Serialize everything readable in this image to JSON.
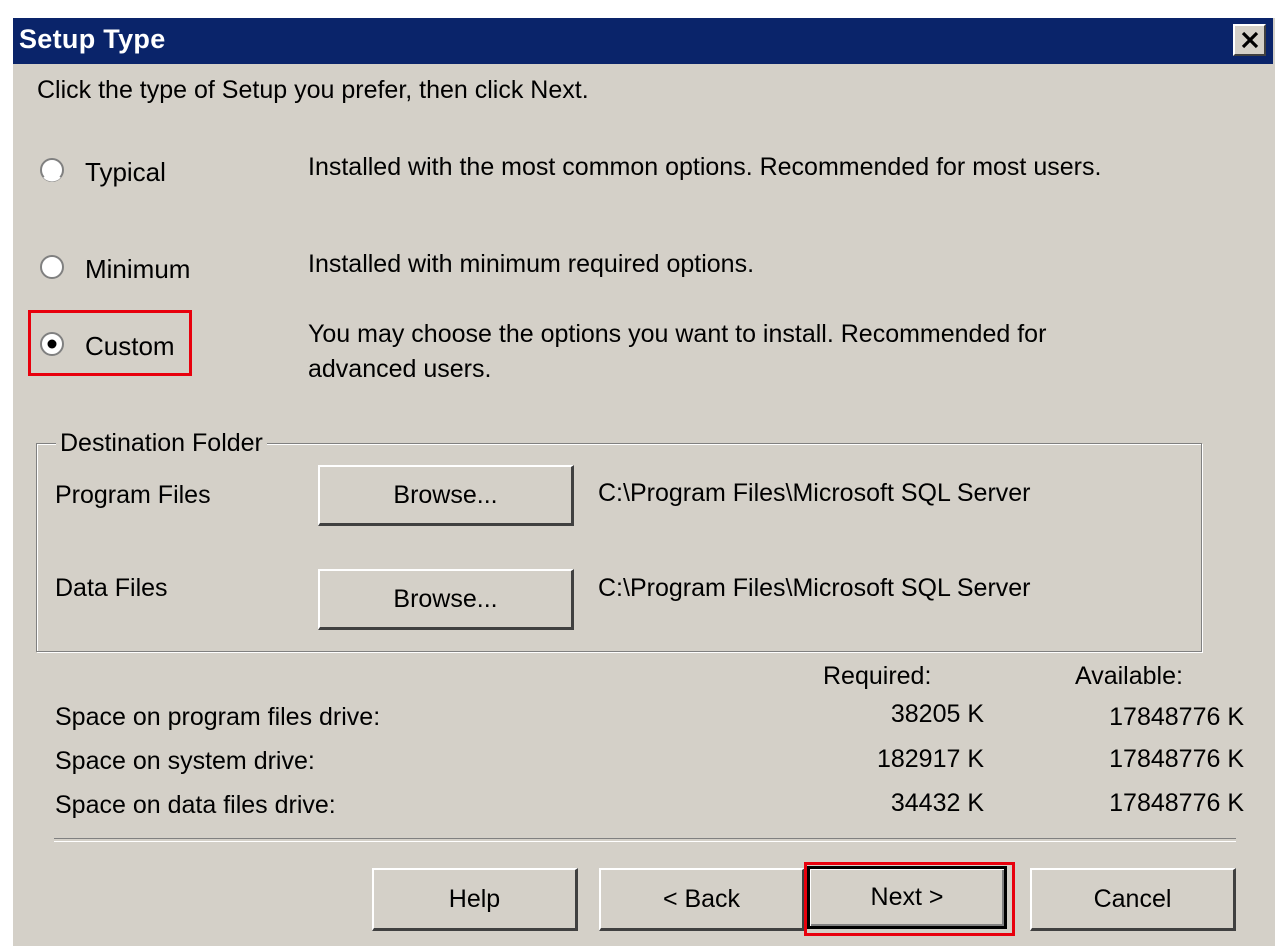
{
  "window": {
    "title": "Setup Type",
    "close_icon": "close-icon"
  },
  "instruction": "Click the type of Setup you prefer, then click Next.",
  "setup_options": [
    {
      "label": "Typical",
      "description": "Installed with the most common options. Recommended for most users.",
      "selected": false
    },
    {
      "label": "Minimum",
      "description": "Installed with minimum required options.",
      "selected": false
    },
    {
      "label": "Custom",
      "description_line1": "You may choose the options you want to install. Recommended for",
      "description_line2": "advanced users.",
      "selected": true
    }
  ],
  "destination": {
    "legend": "Destination Folder",
    "program_files": {
      "label": "Program Files",
      "button": "Browse...",
      "path": "C:\\Program Files\\Microsoft SQL Server"
    },
    "data_files": {
      "label": "Data Files",
      "button": "Browse...",
      "path": "C:\\Program Files\\Microsoft SQL Server"
    }
  },
  "space": {
    "required_header": "Required:",
    "available_header": "Available:",
    "rows": [
      {
        "label": "Space on program files drive:",
        "required": "38205 K",
        "available": "17848776 K"
      },
      {
        "label": "Space on system drive:",
        "required": "182917 K",
        "available": "17848776 K"
      },
      {
        "label": "Space on data files drive:",
        "required": "34432 K",
        "available": "17848776 K"
      }
    ]
  },
  "buttons": {
    "help": "Help",
    "back": "< Back",
    "next": "Next >",
    "cancel": "Cancel"
  },
  "colors": {
    "title_bar": "#0a246a",
    "dialog_face": "#d4d0c8",
    "highlight": "#e8000d"
  }
}
